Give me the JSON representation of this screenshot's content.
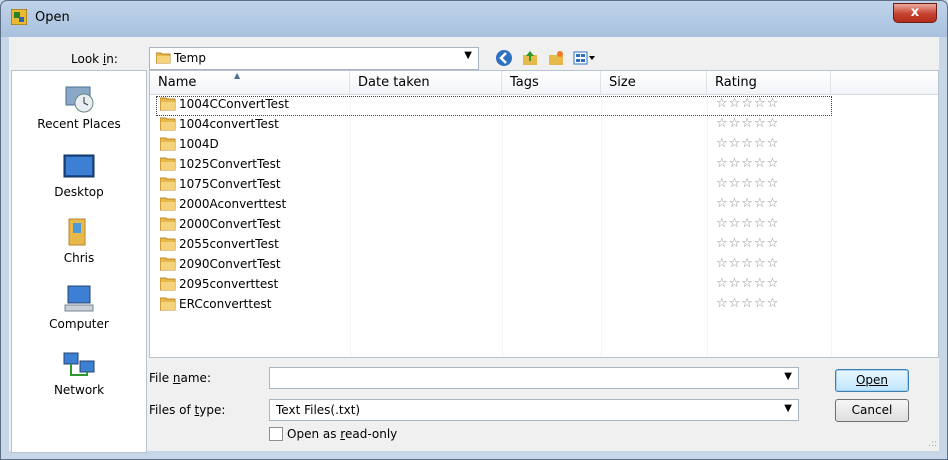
{
  "window": {
    "title": "Open",
    "close_label": "x"
  },
  "lookin": {
    "label": "Look in:",
    "value": "Temp"
  },
  "places": [
    "Recent Places",
    "Desktop",
    "Chris",
    "Computer",
    "Network"
  ],
  "columns": [
    "Name",
    "Date taken",
    "Tags",
    "Size",
    "Rating"
  ],
  "files": [
    {
      "name": "1004CConvertTest",
      "selected": true
    },
    {
      "name": "1004convertTest"
    },
    {
      "name": "1004D"
    },
    {
      "name": "1025ConvertTest"
    },
    {
      "name": "1075ConvertTest"
    },
    {
      "name": "2000Aconverttest"
    },
    {
      "name": "2000ConvertTest"
    },
    {
      "name": "2055convertTest"
    },
    {
      "name": "2090ConvertTest"
    },
    {
      "name": "2095converttest"
    },
    {
      "name": "ERCconverttest"
    }
  ],
  "rating_stars": "☆☆☆☆☆",
  "filename": {
    "label": "File name:",
    "value": ""
  },
  "filetype": {
    "label": "Files of type:",
    "value": "Text Files(.txt)"
  },
  "readonly": {
    "label": "Open as read-only",
    "checked": false
  },
  "buttons": {
    "open": "Open",
    "cancel": "Cancel"
  }
}
